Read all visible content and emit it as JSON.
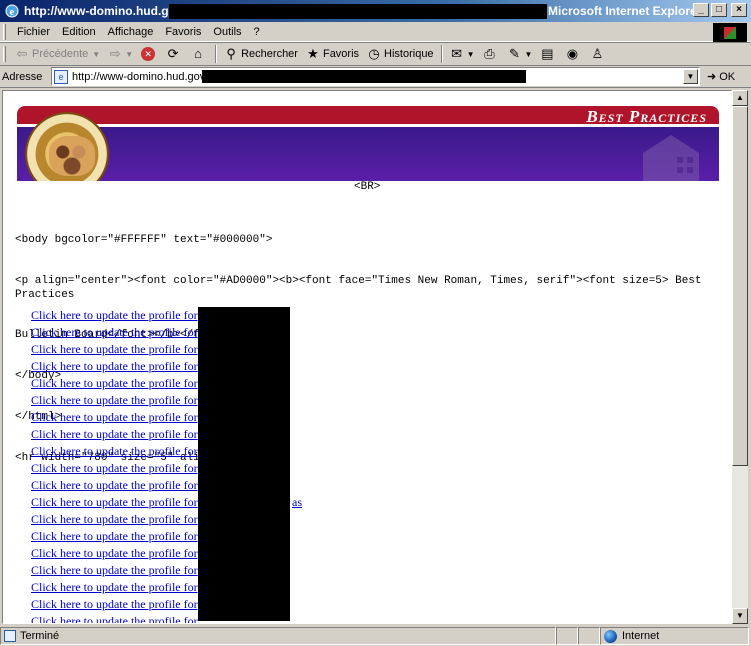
{
  "window": {
    "title_url": "http://www-domino.hud.gov/",
    "title_app": "Microsoft Internet Explorer",
    "minimize": "_",
    "maximize": "□",
    "close": "×"
  },
  "menu": [
    "Fichier",
    "Edition",
    "Affichage",
    "Favoris",
    "Outils",
    "?"
  ],
  "toolbar": {
    "back": "Précédente",
    "search": "Rechercher",
    "favorites": "Favoris",
    "history": "Historique"
  },
  "address": {
    "label": "Adresse",
    "url": "http://www-domino.hud.gov/",
    "go": "OK"
  },
  "banner": {
    "title": "Best Practices"
  },
  "page": {
    "br_text": "<BR>",
    "code_lines": [
      "<body bgcolor=\"#FFFFFF\" text=\"#000000\">",
      "<p align=\"center\"><font color=\"#AD0000\"><b><font face=\"Times New Roman, Times, serif\"><font size=5> Best Practices",
      "Bulletin Board</font></b></font></p>",
      "</body>",
      "</html>",
      "<hr width=\"780\" size=\"5\" align=\"center\">"
    ],
    "link_text": "Click here to update the profile for",
    "link_count": 19,
    "link_suffix": "as"
  },
  "status": {
    "text": "Terminé",
    "zone": "Internet"
  }
}
